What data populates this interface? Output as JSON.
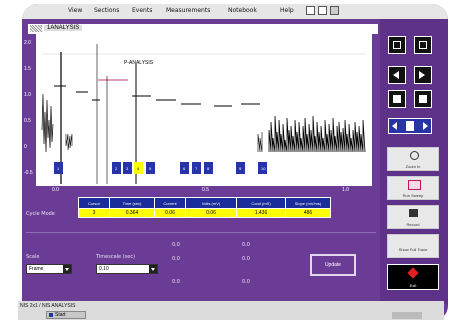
{
  "menu": [
    {
      "label": "View"
    },
    {
      "label": "Sections"
    },
    {
      "label": "Events"
    },
    {
      "label": "Measurements"
    },
    {
      "label": "Notebook"
    },
    {
      "label": "Help"
    }
  ],
  "window": {
    "title": "1ANALYSIS"
  },
  "plot": {
    "y_ticks": [
      "2.0",
      "1.5",
      "1.0",
      "0.5",
      "0",
      "-0.5"
    ],
    "x_ticks": [
      "0.0",
      "0.5",
      "1.0"
    ],
    "header_text": "",
    "cursor_label": "P-ANALYSIS",
    "marker_labels": [
      "1",
      "2",
      "3",
      "4",
      "5",
      "6",
      "7",
      "8",
      "9",
      "10"
    ]
  },
  "results": {
    "row_label": "Cycle Mode",
    "headers": [
      "Cursor",
      "Time (sec)",
      "Current",
      "Volts (mV)",
      "Cond (mS)",
      "Slope (mV/ms)"
    ],
    "values": [
      "3",
      "0.364",
      "0.06",
      "0.06",
      "1.436",
      "486"
    ]
  },
  "controls": {
    "mode_label": "Scale",
    "mode_value": "Frame",
    "timescale_label": "Timescale (sec)",
    "timescale_value": "0.10",
    "stats_a": [
      "0.0",
      "0.0",
      "0.0"
    ],
    "stats_b": [
      "0.0",
      "0.0",
      "0.0"
    ],
    "apply_label": "Update"
  },
  "side": {
    "btn1": "Zoom In",
    "btn2": "Run Sweep",
    "btn3": "Record",
    "btn4": "Show Full Trace",
    "btn5": "Exit"
  },
  "status": {
    "text": "NIS 2x1 / NIS ANALYSIS",
    "start": "Start"
  },
  "colors": {
    "frame": "#6a3c96",
    "header_blue": "#1a2d9a",
    "highlight": "#ffff00"
  }
}
